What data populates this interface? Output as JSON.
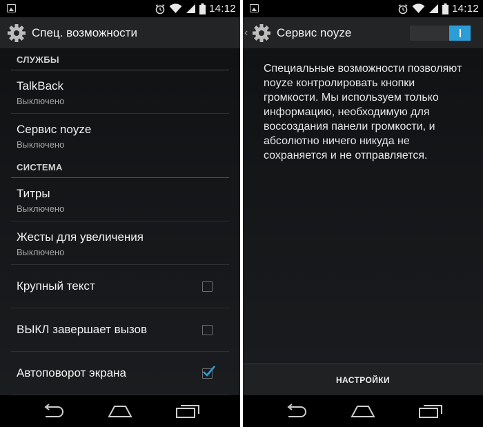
{
  "left": {
    "status_time": "14:12",
    "title": "Спец. возможности",
    "sections": [
      {
        "header": "СЛУЖБЫ",
        "items": [
          {
            "title": "TalkBack",
            "subtitle": "Выключено"
          },
          {
            "title": "Сервис noyze",
            "subtitle": "Выключено"
          }
        ]
      },
      {
        "header": "СИСТЕМА",
        "items": [
          {
            "title": "Титры",
            "subtitle": "Выключено"
          },
          {
            "title": "Жесты для увеличения",
            "subtitle": "Выключено"
          },
          {
            "title": "Крупный текст",
            "checked": false
          },
          {
            "title": "ВЫКЛ завершает вызов",
            "checked": false
          },
          {
            "title": "Автоповорот экрана",
            "checked": true
          }
        ]
      }
    ]
  },
  "right": {
    "status_time": "14:12",
    "title": "Сервис noyze",
    "toggle_on": true,
    "description": "Специальные возможности позволяют noyze контролировать кнопки громкости. Мы используем только информацию, необходимую для воссоздания панели громкости, и абсолютно ничего никуда не сохраняется и не отправляется.",
    "settings_button": "НАСТРОЙКИ"
  },
  "colors": {
    "accent": "#2b9ed8",
    "actionbar": "#222426",
    "background": "#101214"
  },
  "icons": [
    "image-notification-icon",
    "alarm-icon",
    "wifi-icon",
    "signal-icon",
    "battery-icon",
    "gear-icon",
    "back-nav-icon",
    "home-nav-icon",
    "recents-nav-icon",
    "checkmark-icon"
  ]
}
